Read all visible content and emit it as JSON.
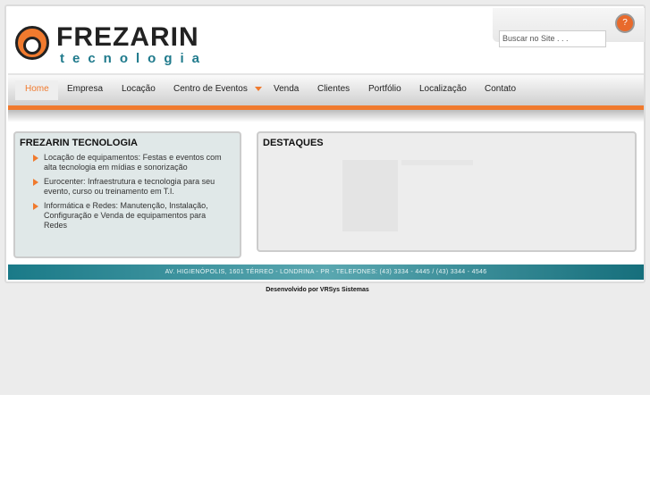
{
  "brand": {
    "name": "FREZARIN",
    "tagline": "tecnologia"
  },
  "search": {
    "placeholder": "Buscar no Site . . ."
  },
  "nav": [
    "Home",
    "Empresa",
    "Locação",
    "Centro de Eventos",
    "Venda",
    "Clientes",
    "Portfólio",
    "Localização",
    "Contato"
  ],
  "left_box": {
    "title": "FREZARIN TECNOLOGIA",
    "items": [
      "Locação de equipamentos: Festas e eventos com alta tecnologia em mídias e sonorização",
      "Eurocenter: Infraestrutura e tecnologia para seu evento, curso ou treinamento em T.I.",
      "Informática e Redes: Manutenção, Instalação, Configuração e Venda de equipamentos para Redes"
    ]
  },
  "right_box": {
    "title": "DESTAQUES"
  },
  "footer": {
    "address": "AV. HIGIENÓPOLIS, 1601 TÉRREO - LONDRINA - PR - TELEFONES: (43) 3334 - 4445 / (43) 3344 - 4546",
    "credit": "Desenvolvido por VRSys Sistemas"
  },
  "colors": {
    "accent": "#f07a2e",
    "teal": "#1f7a8c"
  }
}
